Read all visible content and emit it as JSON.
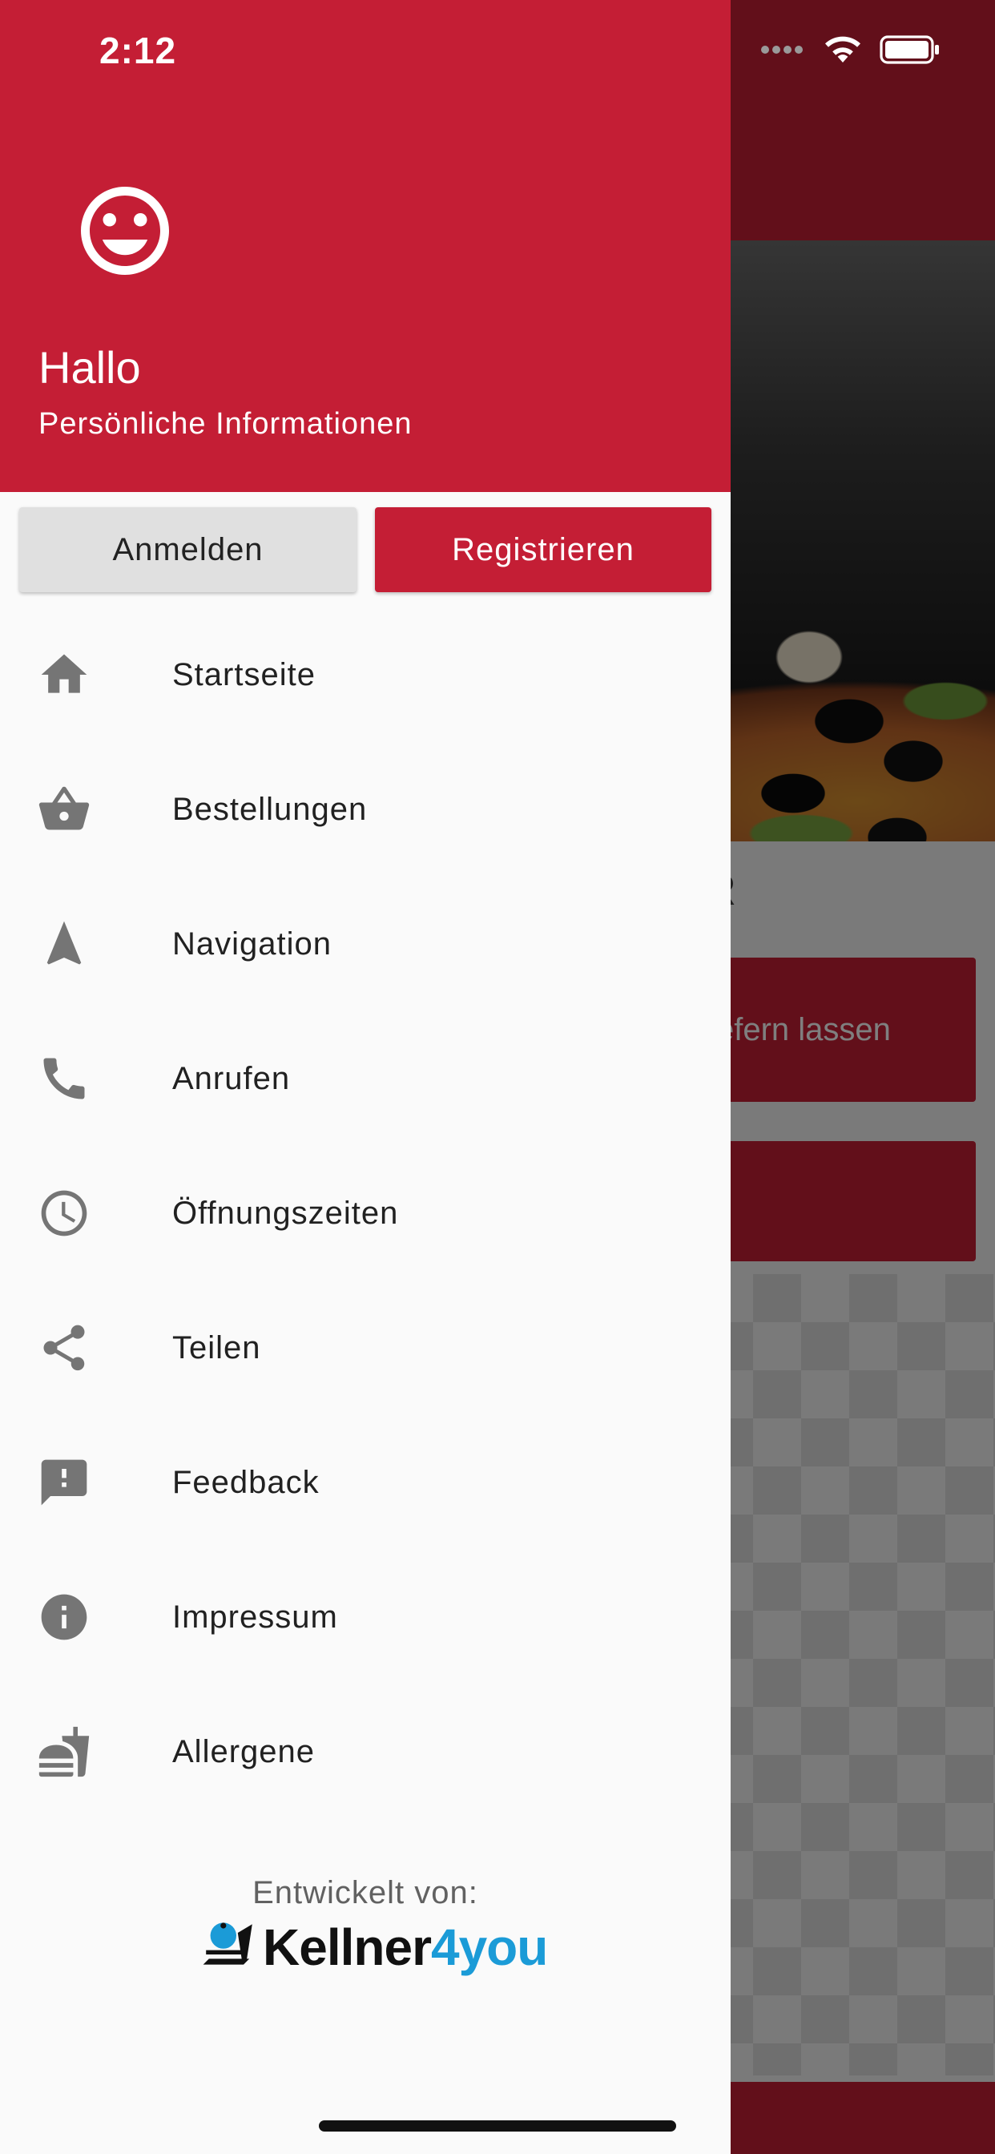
{
  "status_bar": {
    "time": "2:12"
  },
  "drawer": {
    "header": {
      "greeting": "Hallo",
      "subtitle": "Persönliche Informationen",
      "avatar_icon": "smiley-face-icon"
    },
    "auth": {
      "login_label": "Anmelden",
      "register_label": "Registrieren"
    },
    "menu": [
      {
        "label": "Startseite",
        "icon": "home-icon"
      },
      {
        "label": "Bestellungen",
        "icon": "basket-icon"
      },
      {
        "label": "Navigation",
        "icon": "navigation-arrow-icon"
      },
      {
        "label": "Anrufen",
        "icon": "phone-icon"
      },
      {
        "label": "Öffnungszeiten",
        "icon": "clock-icon"
      },
      {
        "label": "Teilen",
        "icon": "share-icon"
      },
      {
        "label": "Feedback",
        "icon": "feedback-icon"
      },
      {
        "label": "Impressum",
        "icon": "info-icon"
      },
      {
        "label": "Allergene",
        "icon": "fastfood-icon"
      }
    ],
    "footer": {
      "developed_by": "Entwickelt von:",
      "brand_part1": "Kellner",
      "brand_part2": "4you"
    }
  },
  "background_screen": {
    "section_text": "R",
    "delivery_button": "efern lassen"
  },
  "colors": {
    "primary": "#c41e35",
    "drawer_bg": "#fafafa",
    "login_button_bg": "#e0e0e0",
    "icon_gray": "#757575",
    "brand_blue": "#1b9bd7"
  }
}
